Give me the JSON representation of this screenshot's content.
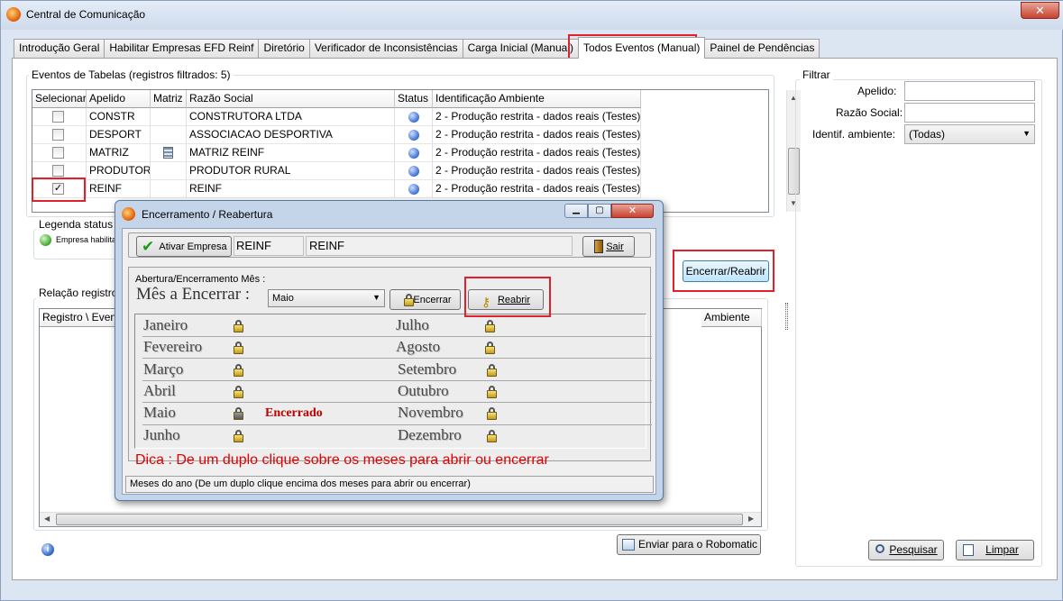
{
  "window": {
    "title": "Central de Comunicação"
  },
  "tabs": [
    {
      "label": "Introdução Geral"
    },
    {
      "label": "Habilitar Empresas EFD Reinf"
    },
    {
      "label": "Diretório"
    },
    {
      "label": "Verificador de Inconsistências"
    },
    {
      "label": "Carga Inicial (Manual)"
    },
    {
      "label": "Todos Eventos (Manual)"
    },
    {
      "label": "Painel de Pendências"
    }
  ],
  "events_table": {
    "title": "Eventos de Tabelas (registros filtrados: 5)",
    "columns": [
      "Selecionar",
      "Apelido",
      "Matriz",
      "Razão Social",
      "Status",
      "Identificação Ambiente"
    ],
    "rows": [
      {
        "selected": false,
        "apelido": "CONSTR",
        "matriz": false,
        "razao": "CONSTRUTORA LTDA",
        "ambiente": "2 - Produção restrita - dados reais (Testes)"
      },
      {
        "selected": false,
        "apelido": "DESPORT",
        "matriz": false,
        "razao": "ASSOCIACAO DESPORTIVA",
        "ambiente": "2 - Produção restrita - dados reais (Testes)"
      },
      {
        "selected": false,
        "apelido": "MATRIZ",
        "matriz": true,
        "razao": "MATRIZ REINF",
        "ambiente": "2 - Produção restrita - dados reais (Testes)"
      },
      {
        "selected": false,
        "apelido": "PRODUTOR",
        "matriz": false,
        "razao": "PRODUTOR RURAL",
        "ambiente": "2 - Produção restrita - dados reais (Testes)"
      },
      {
        "selected": true,
        "apelido": "REINF",
        "matriz": false,
        "razao": "REINF",
        "ambiente": "2 - Produção restrita - dados reais (Testes)"
      }
    ]
  },
  "legend": {
    "title": "Legenda status",
    "item": "Empresa habilita"
  },
  "encerrar_button": "Encerrar/Reabrir",
  "relacao": {
    "title": "Relação registros",
    "col_registro": "Registro \\ Even",
    "col_ambiente": "Ambiente"
  },
  "enviar_button": "Enviar para o Robomatic",
  "filter": {
    "title": "Filtrar",
    "apelido_label": "Apelido:",
    "razao_label": "Razão Social:",
    "ambiente_label": "Identif. ambiente:",
    "ambiente_value": "(Todas)",
    "pesquisar": "Pesquisar",
    "limpar": "Limpar"
  },
  "dialog": {
    "title": "Encerramento / Reabertura",
    "ativar_button": "Ativar Empresa",
    "empresa_apelido": "REINF",
    "empresa_nome": "REINF",
    "sair_button": "Sair",
    "group_title": "Abertura/Encerramento Mês :",
    "mes_label": "Mês a Encerrar :",
    "mes_value": "Maio",
    "encerrar_button": "Encerrar",
    "reabrir_button": "Reabrir",
    "months_left": [
      "Janeiro",
      "Fevereiro",
      "Março",
      "Abril",
      "Maio",
      "Junho"
    ],
    "months_right": [
      "Julho",
      "Agosto",
      "Setembro",
      "Outubro",
      "Novembro",
      "Dezembro"
    ],
    "status_closed": "Encerrado",
    "dica": "Dica : De um duplo clique sobre os meses para  abrir ou encerrar",
    "statusbar": "Meses do ano (De um duplo clique encima dos meses para  abrir ou encerrar)"
  },
  "colors": {
    "highlight": "#e0202a",
    "dica": "#e00000",
    "encerrado": "#c00000"
  }
}
